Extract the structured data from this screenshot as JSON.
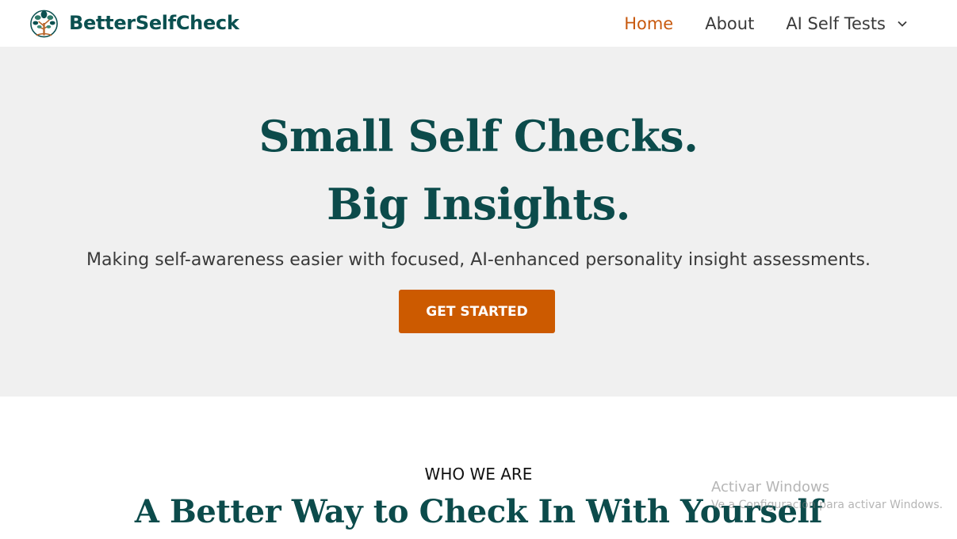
{
  "header": {
    "brand_name": "BetterSelfCheck",
    "logo_icon": "tree-logo-icon",
    "nav": {
      "home": "Home",
      "about": "About",
      "ai_tests": "AI Self Tests",
      "dropdown_icon": "chevron-down-icon"
    }
  },
  "hero": {
    "title_line1": "Small Self Checks.",
    "title_line2": "Big Insights.",
    "subtitle": "Making self-awareness easier with focused, AI-enhanced personality insight assessments.",
    "cta_label": "GET STARTED"
  },
  "who_we_are": {
    "eyebrow": "WHO WE ARE",
    "title": "A Better Way to Check In With Yourself"
  },
  "watermark": {
    "title": "Activar Windows",
    "subtitle": "Ve a Configuración para activar Windows."
  },
  "colors": {
    "brand_teal": "#0c4b4b",
    "accent_orange": "#cc5a00",
    "hero_bg": "#f0f0f0",
    "nav_active": "#c85a0f"
  }
}
